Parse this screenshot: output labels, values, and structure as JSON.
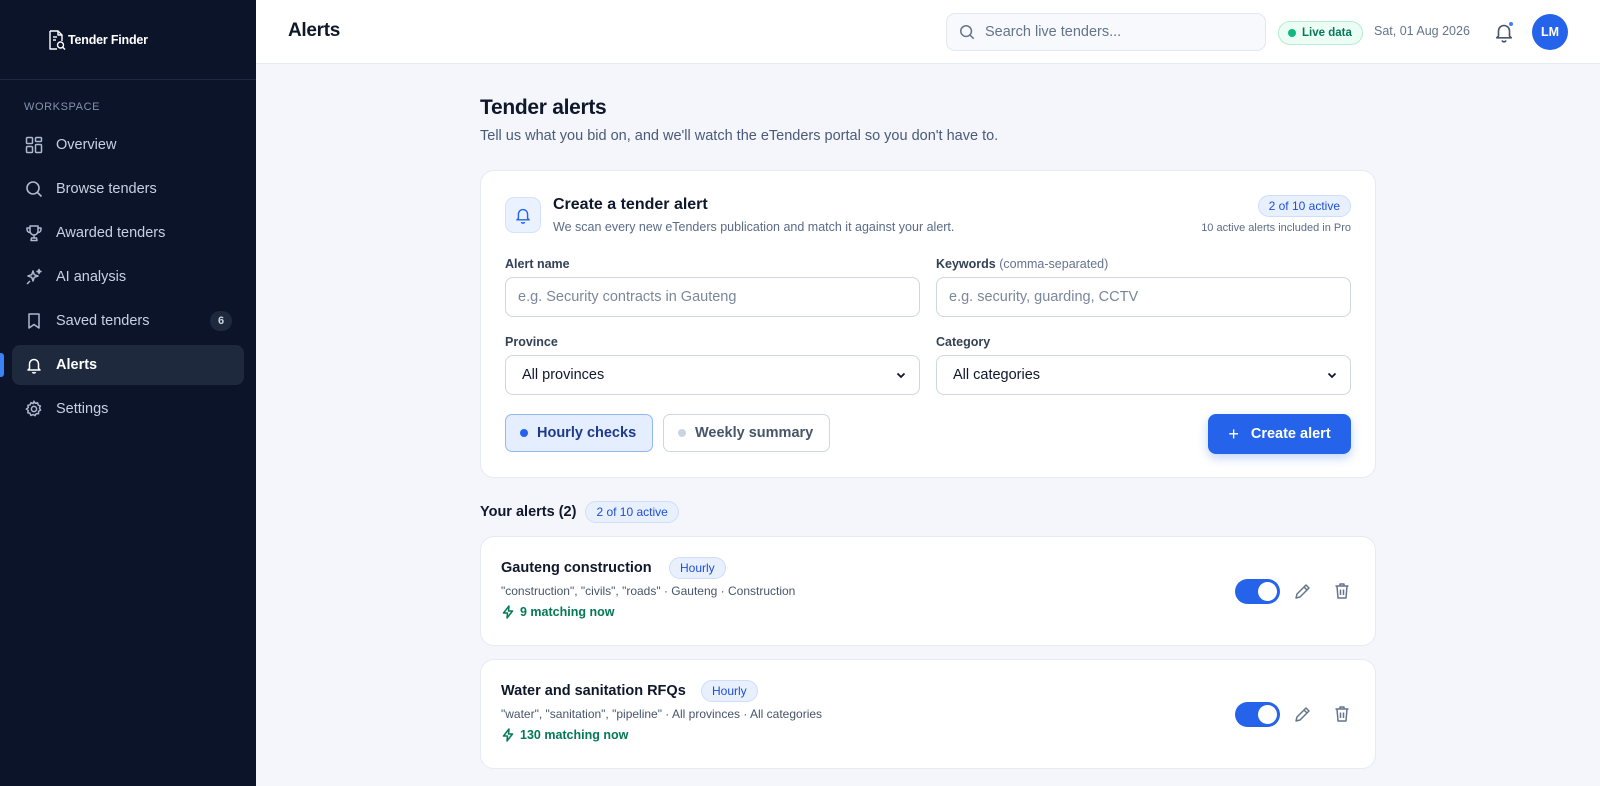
{
  "sidebar": {
    "brand": "Tender Finder",
    "section": "WORKSPACE",
    "items": [
      {
        "label": "Overview",
        "icon": "grid-icon"
      },
      {
        "label": "Browse tenders",
        "icon": "search-icon"
      },
      {
        "label": "Awarded tenders",
        "icon": "trophy-icon"
      },
      {
        "label": "AI analysis",
        "icon": "sparkles-icon"
      },
      {
        "label": "Saved tenders",
        "icon": "bookmark-icon",
        "badge": "6"
      },
      {
        "label": "Alerts",
        "icon": "bell-icon",
        "active": true
      },
      {
        "label": "Settings",
        "icon": "gear-icon"
      }
    ]
  },
  "topbar": {
    "title": "Alerts",
    "search_placeholder": "Search live tenders...",
    "live_label": "Live data",
    "date": "Sat, 01 Aug 2026",
    "avatar_initials": "LM"
  },
  "page": {
    "heading": "Tender alerts",
    "subheading": "Tell us what you bid on, and we'll watch the eTenders portal so you don't have to."
  },
  "create": {
    "title": "Create a tender alert",
    "description": "We scan every new eTenders publication and match it against your alert.",
    "active_pill": "2 of 10 active",
    "plan_note": "10 active alerts included in Pro",
    "name_label": "Alert name",
    "name_placeholder": "e.g. Security contracts in Gauteng",
    "keywords_label": "Keywords",
    "keywords_hint": "(comma-separated)",
    "keywords_placeholder": "e.g. security, guarding, CCTV",
    "province_label": "Province",
    "province_value": "All provinces",
    "category_label": "Category",
    "category_value": "All categories",
    "freq_hourly": "Hourly checks",
    "freq_weekly": "Weekly summary",
    "button": "Create alert"
  },
  "alerts_list": {
    "title": "Your alerts (2)",
    "pill": "2 of 10 active",
    "items": [
      {
        "name": "Gauteng construction",
        "frequency": "Hourly",
        "meta": "\"construction\", \"civils\", \"roads\" · Gauteng · Construction",
        "matches": "9 matching now",
        "enabled": true
      },
      {
        "name": "Water and sanitation RFQs",
        "frequency": "Hourly",
        "meta": "\"water\", \"sanitation\", \"pipeline\" · All provinces · All categories",
        "matches": "130 matching now",
        "enabled": true
      }
    ]
  },
  "colors": {
    "sidebar_bg": "#0b1429",
    "accent": "#2563eb",
    "success": "#047857",
    "page_bg": "#f4f6fb"
  }
}
